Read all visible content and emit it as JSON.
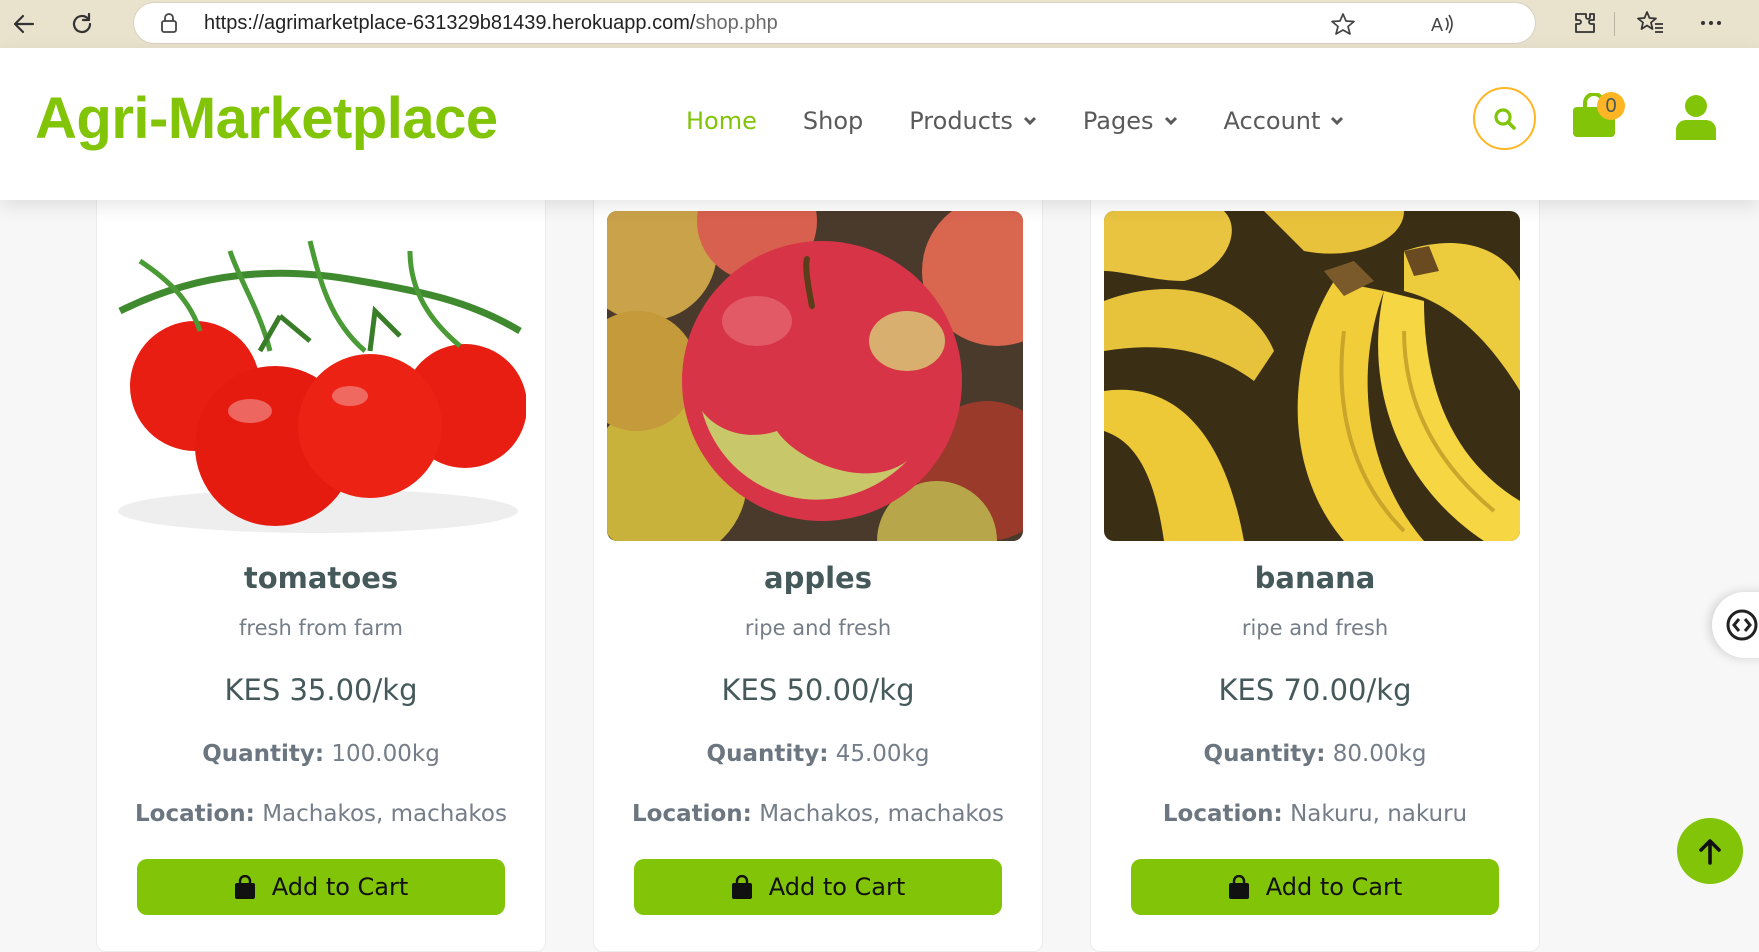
{
  "browser": {
    "url_host": "https://agrimarketplace-631329b81439.herokuapp.com/",
    "url_path": "shop.php"
  },
  "site": {
    "logo": "Agri-Marketplace",
    "nav": {
      "home": "Home",
      "shop": "Shop",
      "products": "Products",
      "pages": "Pages",
      "account": "Account"
    },
    "cart_count": "0"
  },
  "products": [
    {
      "name": "tomatoes",
      "description": "fresh from farm",
      "price": "KES 35.00/kg",
      "quantity_label": "Quantity:",
      "quantity": "100.00kg",
      "location_label": "Location:",
      "location": "Machakos, machakos",
      "button": "Add to Cart"
    },
    {
      "name": "apples",
      "description": "ripe and fresh",
      "price": "KES 50.00/kg",
      "quantity_label": "Quantity:",
      "quantity": "45.00kg",
      "location_label": "Location:",
      "location": "Machakos, machakos",
      "button": "Add to Cart"
    },
    {
      "name": "banana",
      "description": "ripe and fresh",
      "price": "KES 70.00/kg",
      "quantity_label": "Quantity:",
      "quantity": "80.00kg",
      "location_label": "Location:",
      "location": "Nakuru, nakuru",
      "button": "Add to Cart"
    }
  ],
  "colors": {
    "primary": "#81c408",
    "secondary": "#ffb524",
    "dark": "#45595b",
    "muted": "#747d88"
  },
  "icons": [
    "back-icon",
    "refresh-icon",
    "lock-icon",
    "read-aloud-icon",
    "star-icon",
    "extensions-icon",
    "favorites-icon",
    "more-icon",
    "search-icon",
    "shopping-bag-icon",
    "user-icon",
    "arrow-up-icon"
  ]
}
